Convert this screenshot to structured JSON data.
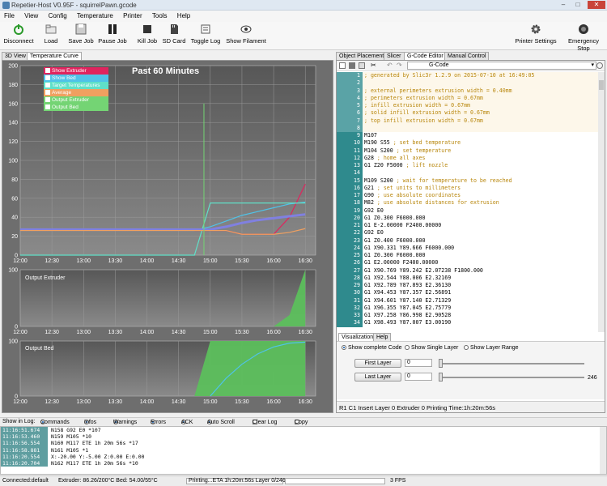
{
  "window": {
    "title": "Repetier-Host V0.95F - squirrelPawn.gcode"
  },
  "menu": [
    "File",
    "View",
    "Config",
    "Temperature",
    "Printer",
    "Tools",
    "Help"
  ],
  "toolbar": {
    "disconnect": "Disconnect",
    "load": "Load",
    "save_job": "Save Job",
    "pause_job": "Pause Job",
    "kill_job": "Kill Job",
    "sd_card": "SD Card",
    "toggle_log": "Toggle Log",
    "show_filament": "Show Filament",
    "printer_settings": "Printer Settings",
    "emergency_stop": "Emergency Stop"
  },
  "left_tabs": [
    "3D View",
    "Temperature Curve"
  ],
  "right_tabs": [
    "Object Placement",
    "Slicer",
    "G-Code Editor",
    "Manual Control"
  ],
  "temp_chart": {
    "title": "Past 60 Minutes",
    "legend": [
      "Show Extruder",
      "Show Bed",
      "Target Temperatures",
      "Average",
      "Output Extruder",
      "Output Bed"
    ],
    "legend_colors": [
      "#e0245e",
      "#4fc3e8",
      "#60e0c8",
      "#f0a060",
      "#74d474",
      "#74d474"
    ],
    "panel2_label": "Output Extruder",
    "panel3_label": "Output Bed"
  },
  "chart_data": [
    {
      "type": "line",
      "title": "Past 60 Minutes",
      "x": [
        "12:00",
        "12:15",
        "12:30",
        "12:45",
        "13:00",
        "13:15",
        "13:30",
        "13:45",
        "14:00",
        "14:15",
        "14:30",
        "14:45",
        "15:00",
        "15:15",
        "15:30",
        "15:45",
        "16:00",
        "16:15",
        "16:30"
      ],
      "ylim": [
        0,
        200
      ],
      "yticks": [
        0,
        20,
        40,
        60,
        80,
        100,
        120,
        140,
        160,
        180,
        200
      ],
      "series": [
        {
          "name": "Show Extruder",
          "color": "#e0245e",
          "values": [
            26,
            26,
            26,
            26,
            26,
            26,
            26,
            26,
            26,
            26,
            26,
            26,
            26,
            26,
            22,
            22,
            22,
            40,
            75
          ]
        },
        {
          "name": "Show Bed",
          "color": "#4fc3e8",
          "values": [
            26,
            26,
            26,
            26,
            26,
            26,
            26,
            26,
            26,
            26,
            26,
            26,
            30,
            36,
            42,
            46,
            50,
            54,
            56
          ]
        },
        {
          "name": "Target Temperatures",
          "color": "#60e0c8",
          "values": [
            0,
            0,
            0,
            0,
            0,
            0,
            0,
            0,
            0,
            0,
            0,
            0,
            55,
            55,
            55,
            55,
            55,
            55,
            55
          ]
        },
        {
          "name": "Average",
          "color": "#8080e0",
          "values": [
            27,
            27,
            27,
            27,
            27,
            27,
            27,
            27,
            27,
            27,
            27,
            27,
            27,
            30,
            34,
            37,
            39,
            41,
            43
          ]
        },
        {
          "name": "Output Extruder",
          "color": "#f0a060",
          "values": [
            26,
            26,
            26,
            26,
            26,
            26,
            26,
            26,
            26,
            26,
            26,
            26,
            26,
            26,
            22,
            22,
            22,
            24,
            28
          ]
        },
        {
          "name": "Output Bed",
          "color": "#74d474",
          "values": [
            0,
            0,
            0,
            0,
            0,
            0,
            0,
            0,
            0,
            0,
            0,
            0,
            0,
            0,
            0,
            0,
            0,
            0,
            0
          ]
        }
      ]
    },
    {
      "type": "area",
      "title": "Output Extruder",
      "x": [
        "12:00",
        "12:15",
        "12:30",
        "12:45",
        "13:00",
        "13:15",
        "13:30",
        "13:45",
        "14:00",
        "14:15",
        "14:30",
        "14:45",
        "15:00",
        "15:15",
        "15:30",
        "15:45",
        "16:00",
        "16:15",
        "16:30"
      ],
      "ylim": [
        0,
        100
      ],
      "yticks": [
        0,
        100
      ],
      "values": [
        0,
        0,
        0,
        0,
        0,
        0,
        0,
        0,
        0,
        0,
        0,
        0,
        0,
        0,
        0,
        0,
        0,
        20,
        100
      ]
    },
    {
      "type": "area",
      "title": "Output Bed",
      "x": [
        "12:00",
        "12:15",
        "12:30",
        "12:45",
        "13:00",
        "13:15",
        "13:30",
        "13:45",
        "14:00",
        "14:15",
        "14:30",
        "14:45",
        "15:00",
        "15:15",
        "15:30",
        "15:45",
        "16:00",
        "16:15",
        "16:30"
      ],
      "ylim": [
        0,
        100
      ],
      "yticks": [
        0,
        100
      ],
      "values": [
        0,
        0,
        0,
        0,
        0,
        0,
        0,
        0,
        0,
        0,
        0,
        0,
        100,
        100,
        100,
        100,
        100,
        100,
        100
      ]
    }
  ],
  "gcode": {
    "header_label": "G-Code",
    "lines": [
      {
        "n": "1",
        "t": "; generated by Slic3r 1.2.9 on 2015-07-10 at 16:49:05",
        "c": true
      },
      {
        "n": "2",
        "t": "",
        "c": false
      },
      {
        "n": "3",
        "t": "; external perimeters extrusion width = 0.40mm",
        "c": true
      },
      {
        "n": "4",
        "t": "; perimeters extrusion width = 0.67mm",
        "c": true
      },
      {
        "n": "5",
        "t": "; infill extrusion width = 0.67mm",
        "c": true
      },
      {
        "n": "6",
        "t": "; solid infill extrusion width = 0.67mm",
        "c": true
      },
      {
        "n": "7",
        "t": "; top infill extrusion width = 0.67mm",
        "c": true
      },
      {
        "n": "8",
        "t": "",
        "c": false
      },
      {
        "n": "9",
        "t": "M107",
        "c": false
      },
      {
        "n": "10",
        "t": "M190 S55 ; set bed temperature",
        "c": false
      },
      {
        "n": "11",
        "t": "M104 S200 ; set temperature",
        "c": false
      },
      {
        "n": "12",
        "t": "G28 ; home all axes",
        "c": false
      },
      {
        "n": "13",
        "t": "G1 Z20 F5000 ; lift nozzle",
        "c": false
      },
      {
        "n": "14",
        "t": "",
        "c": false
      },
      {
        "n": "15",
        "t": "M109 S200 ; wait for temperature to be reached",
        "c": false
      },
      {
        "n": "16",
        "t": "G21 ; set units to millimeters",
        "c": false
      },
      {
        "n": "17",
        "t": "G90 ; use absolute coordinates",
        "c": false
      },
      {
        "n": "18",
        "t": "M82 ; use absolute distances for extrusion",
        "c": false
      },
      {
        "n": "19",
        "t": "G92 E0",
        "c": false
      },
      {
        "n": "20",
        "t": "G1 Z0.300 F6000.000",
        "c": false
      },
      {
        "n": "21",
        "t": "G1 E-2.00000 F2400.00000",
        "c": false
      },
      {
        "n": "22",
        "t": "G92 E0",
        "c": false
      },
      {
        "n": "23",
        "t": "G1 Z0.400 F6000.000",
        "c": false
      },
      {
        "n": "24",
        "t": "G1 X90.331 Y89.666 F6000.000",
        "c": false
      },
      {
        "n": "25",
        "t": "G1 Z0.300 F6000.000",
        "c": false
      },
      {
        "n": "26",
        "t": "G1 E2.00000 F2400.00000",
        "c": false
      },
      {
        "n": "27",
        "t": "G1 X90.769 Y89.242 E2.07238 F1800.000",
        "c": false
      },
      {
        "n": "28",
        "t": "G1 X92.544 Y88.006 E2.32169",
        "c": false
      },
      {
        "n": "29",
        "t": "G1 X92.789 Y87.893 E2.36130",
        "c": false
      },
      {
        "n": "30",
        "t": "G1 X94.453 Y87.357 E2.56891",
        "c": false
      },
      {
        "n": "31",
        "t": "G1 X94.601 Y87.140 E2.71329",
        "c": false
      },
      {
        "n": "32",
        "t": "G1 X96.355 Y87.045 E2.75779",
        "c": false
      },
      {
        "n": "33",
        "t": "G1 X97.258 Y86.998 E2.90528",
        "c": false
      },
      {
        "n": "34",
        "t": "G1 X98.493 Y87.007 E3.00190",
        "c": false
      }
    ]
  },
  "visualization": {
    "tabs": [
      "Visualization",
      "Help"
    ],
    "show_complete": "Show complete Code",
    "show_single": "Show Single Layer",
    "show_range": "Show Layer Range",
    "first_layer": "First Layer",
    "last_layer": "Last Layer",
    "first_value": "0",
    "last_value": "0",
    "max_layer": "246"
  },
  "editor_status": "R1   C1   Insert   Layer 0   Extruder 0   Printing Time:1h:20m:56s",
  "log_toolbar": {
    "show_in_log": "Show in Log:",
    "items": [
      "Commands",
      "Infos",
      "Warnings",
      "Errors",
      "ACK",
      "Auto Scroll",
      "Clear Log",
      "Copy"
    ]
  },
  "log": [
    {
      "ts": "11:16:51.674",
      "msg": "N158 G92 E0 *107"
    },
    {
      "ts": "11:16:53.460",
      "msg": "N159 M105 *10"
    },
    {
      "ts": "11:16:56.554",
      "msg": "N160 M117 ETE 1h 20m 56s *17"
    },
    {
      "ts": "11:16:58.881",
      "msg": "N161 M105 *1"
    },
    {
      "ts": "11:16:20.554",
      "msg": "X:-20.00 Y:-5.00 Z:0.00 E:0.00"
    },
    {
      "ts": "11:16:20.704",
      "msg": "N162 M117 ETE 1h 20m 56s *10"
    }
  ],
  "status": {
    "connection": "Connected:default",
    "temps": "Extruder: 86.26/200°C Bed: 54.00/55°C",
    "progress_text": "Printing...ETA 1h:20m:56s Layer 0/246",
    "fps": "3 FPS"
  }
}
